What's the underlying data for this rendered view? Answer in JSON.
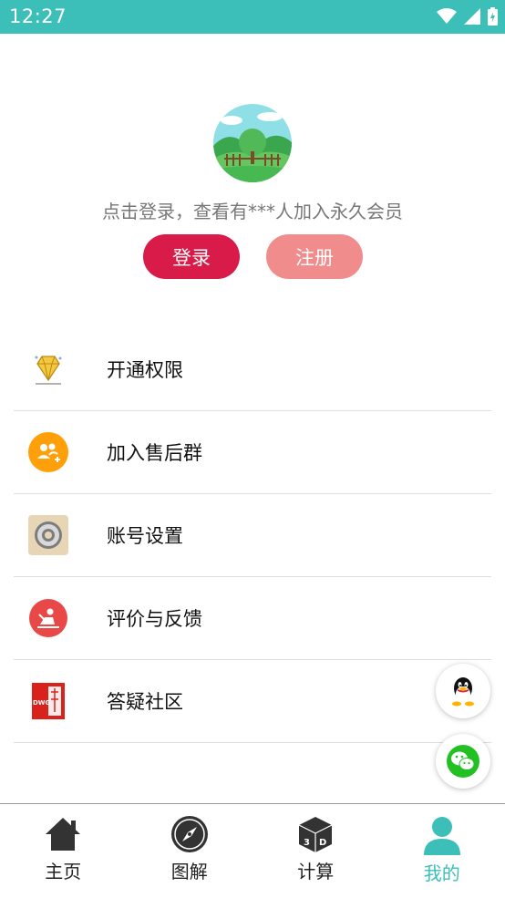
{
  "status_bar": {
    "time": "12:27"
  },
  "profile": {
    "hint": "点击登录，查看有***人加入永久会员",
    "login_label": "登录",
    "register_label": "注册"
  },
  "menu": {
    "items": [
      {
        "label": "开通权限",
        "icon": "diamond-icon"
      },
      {
        "label": "加入售后群",
        "icon": "group-add-icon"
      },
      {
        "label": "账号设置",
        "icon": "settings-icon"
      },
      {
        "label": "评价与反馈",
        "icon": "feedback-icon"
      },
      {
        "label": "答疑社区",
        "icon": "dwg-file-icon"
      }
    ]
  },
  "floating": {
    "qq_icon": "qq-icon",
    "wechat_icon": "wechat-icon"
  },
  "bottom_nav": {
    "items": [
      {
        "label": "主页",
        "icon": "home-icon"
      },
      {
        "label": "图解",
        "icon": "compass-icon"
      },
      {
        "label": "计算",
        "icon": "3d-cube-icon"
      },
      {
        "label": "我的",
        "icon": "user-icon",
        "active": true
      }
    ]
  },
  "colors": {
    "accent": "#3bbfb8",
    "login": "#d81b48",
    "register": "#f08c8c"
  }
}
